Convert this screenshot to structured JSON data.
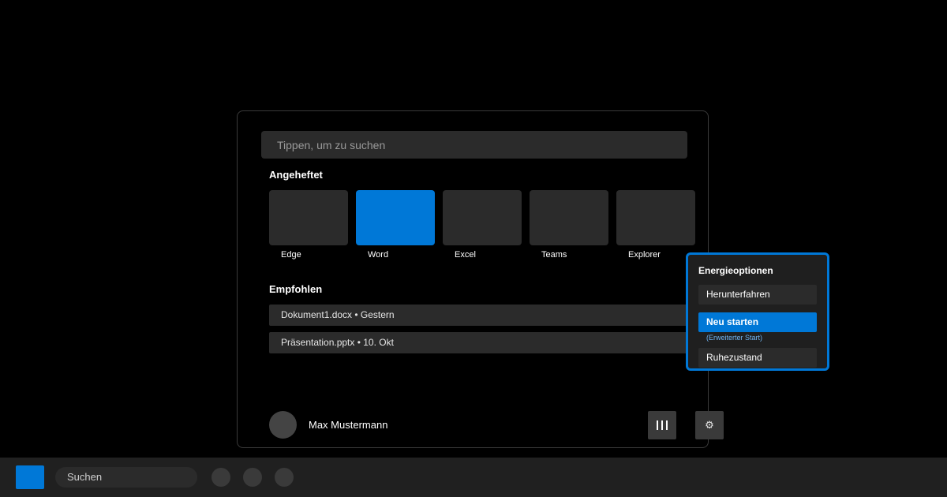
{
  "colors": {
    "accent": "#0078d7",
    "background": "#000000",
    "tile": "#2b2b2b",
    "taskbar": "#202020"
  },
  "start_menu": {
    "search": {
      "placeholder": "Tippen, um zu suchen"
    },
    "pinned_title": "Angeheftet",
    "pinned": [
      {
        "label": "Edge"
      },
      {
        "label": "Word"
      },
      {
        "label": "Excel"
      },
      {
        "label": "Teams"
      },
      {
        "label": "Explorer"
      }
    ],
    "recommended_title": "Empfohlen",
    "recommended": [
      {
        "label": "Dokument1.docx • Gestern"
      },
      {
        "label": "Präsentation.pptx • 10. Okt"
      }
    ],
    "user": {
      "name": "Max Mustermann"
    },
    "power_icon": "power-bars-icon",
    "settings_icon": "⚙"
  },
  "power_menu": {
    "title": "Energieoptionen",
    "options": [
      {
        "label": "Herunterfahren"
      },
      {
        "label": "Neu starten",
        "note": "(Erweiterter Start)"
      },
      {
        "label": "Ruhezustand"
      }
    ]
  },
  "taskbar": {
    "search_label": "Suchen"
  }
}
